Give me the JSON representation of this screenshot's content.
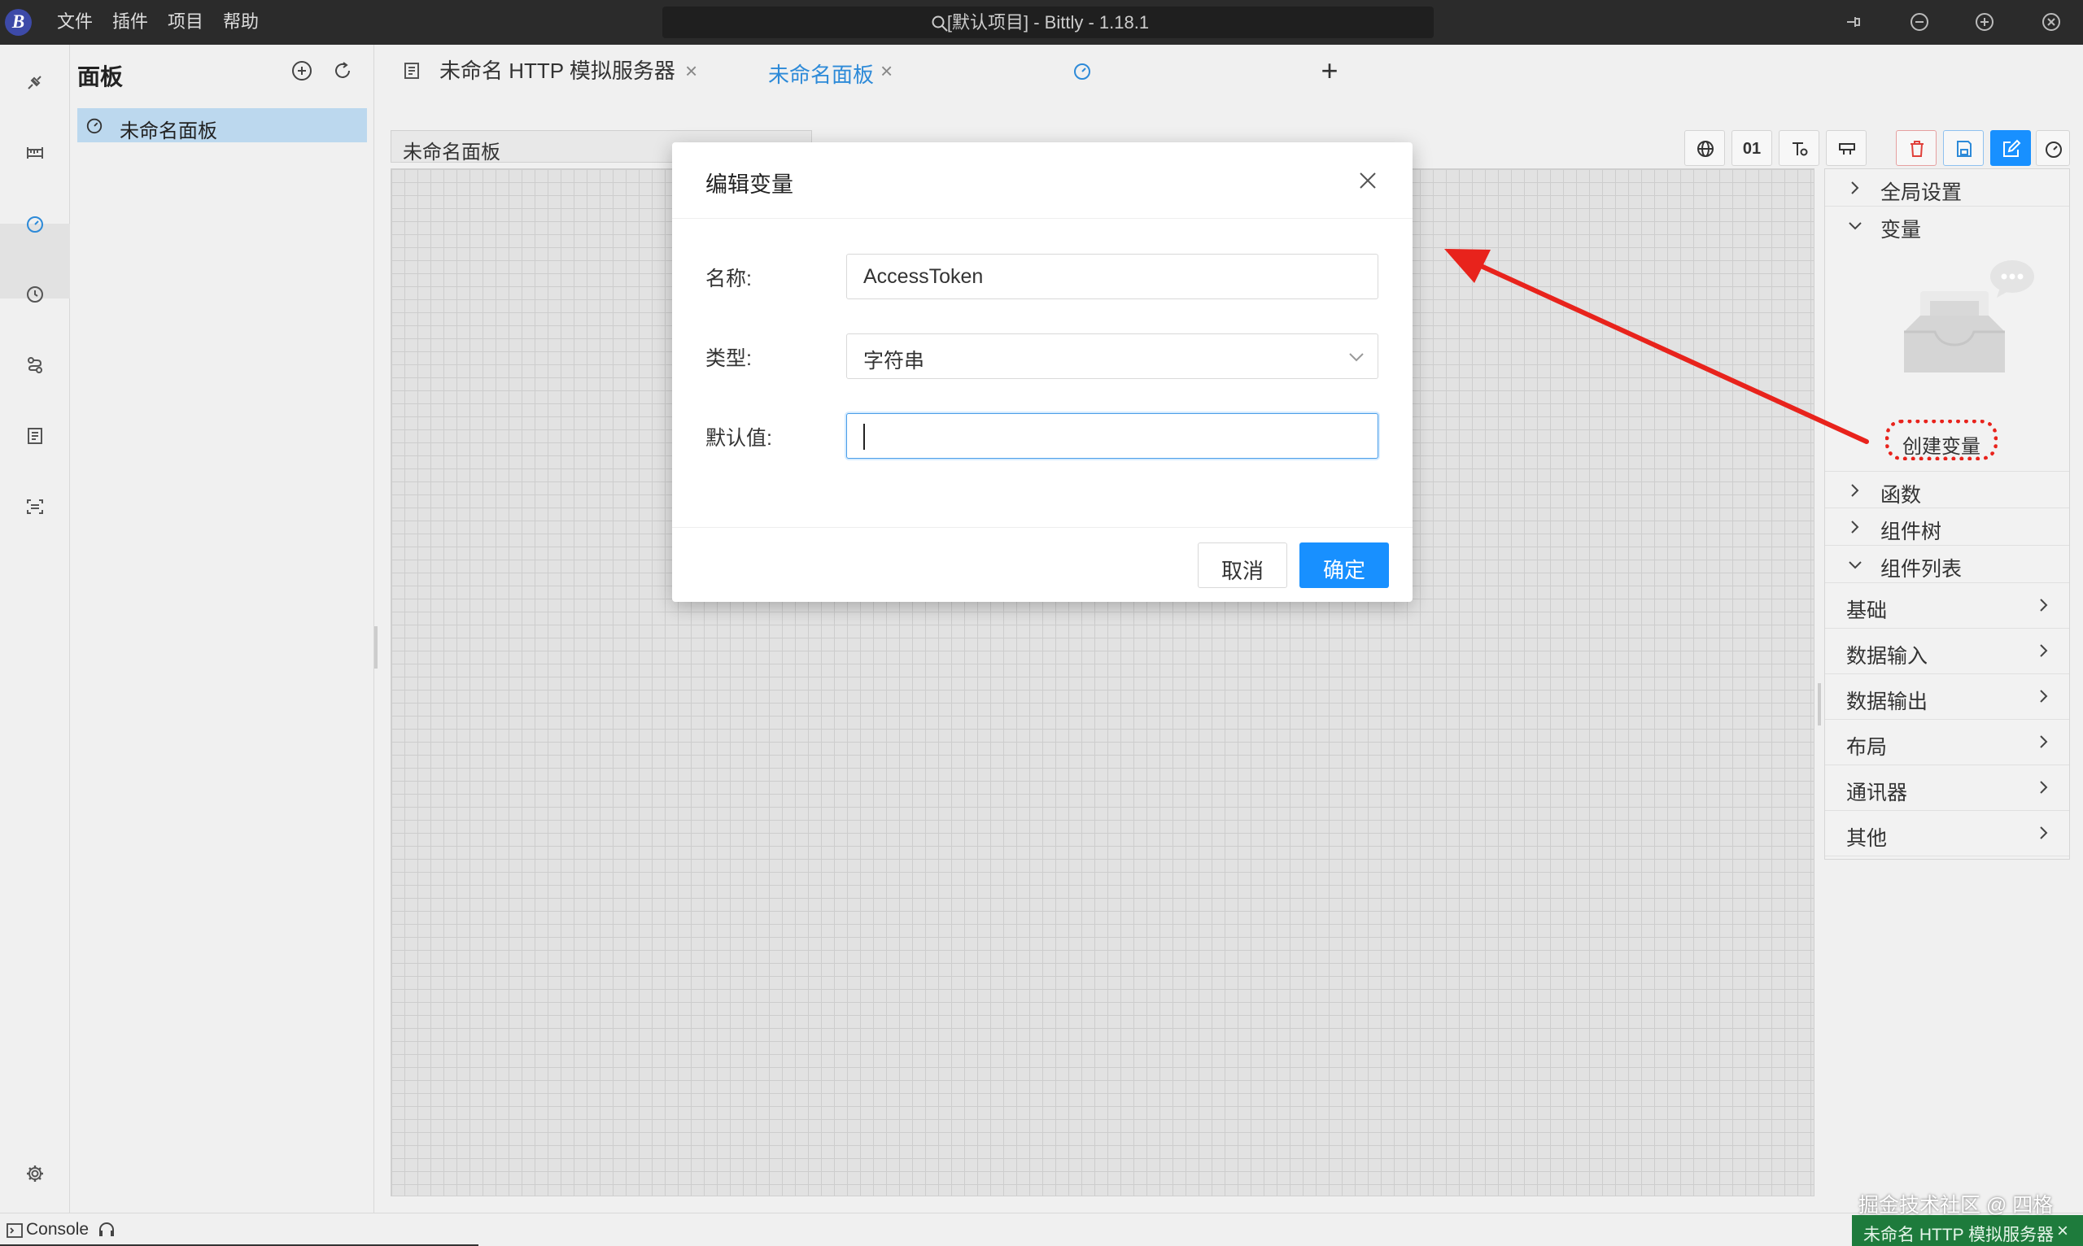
{
  "app": {
    "title": "[默认项目] - Bittly - 1.18.1",
    "logo_letter": "B"
  },
  "menu": [
    "文件",
    "插件",
    "项目",
    "帮助"
  ],
  "sidebar": {
    "title": "面板",
    "items": [
      {
        "label": "未命名面板"
      }
    ]
  },
  "tabs": [
    {
      "label": "未命名 HTTP 模拟服务器",
      "close": "×",
      "active": false
    },
    {
      "label": "未命名面板",
      "close": "×",
      "active": true
    }
  ],
  "tab_new": "+",
  "canvas": {
    "name": "未命名面板",
    "toolbar_binary_label": "01"
  },
  "right_panel": {
    "sections": [
      {
        "label": "全局设置",
        "expanded": false
      },
      {
        "label": "变量",
        "expanded": true
      },
      {
        "label": "函数",
        "expanded": false
      },
      {
        "label": "组件树",
        "expanded": false
      },
      {
        "label": "组件列表",
        "expanded": true
      }
    ],
    "create_variable_button": "创建变量",
    "component_categories": [
      "基础",
      "数据输入",
      "数据输出",
      "布局",
      "通讯器",
      "其他"
    ]
  },
  "dialog": {
    "title": "编辑变量",
    "fields": {
      "name_label": "名称:",
      "name_value": "AccessToken",
      "type_label": "类型:",
      "type_value": "字符串",
      "default_label": "默认值:",
      "default_value": ""
    },
    "cancel_label": "取消",
    "ok_label": "确定"
  },
  "status_bar": {
    "console_label": "Console",
    "server_status": "未命名 HTTP 模拟服务器",
    "server_close": "×"
  },
  "watermark": "掘金技术社区 @ 四格",
  "colors": {
    "titlebar": "#2b2b2b",
    "primary": "#1890ff",
    "annotation_red": "#e8231c",
    "status_green": "#1e7b3c",
    "selected_item": "#bcd8ee"
  },
  "icons": {
    "activity_bar": [
      "plug-icon",
      "ruler-icon",
      "dashboard-icon",
      "clock-icon",
      "route-icon",
      "mock-server-icon",
      "scan-icon",
      "gear-icon"
    ],
    "canvas_toolbar": [
      "globe-icon",
      "binary-icon",
      "chart-settings-icon",
      "layout-icon",
      "delete-icon",
      "save-icon",
      "edit-icon",
      "dashboard-icon"
    ]
  }
}
